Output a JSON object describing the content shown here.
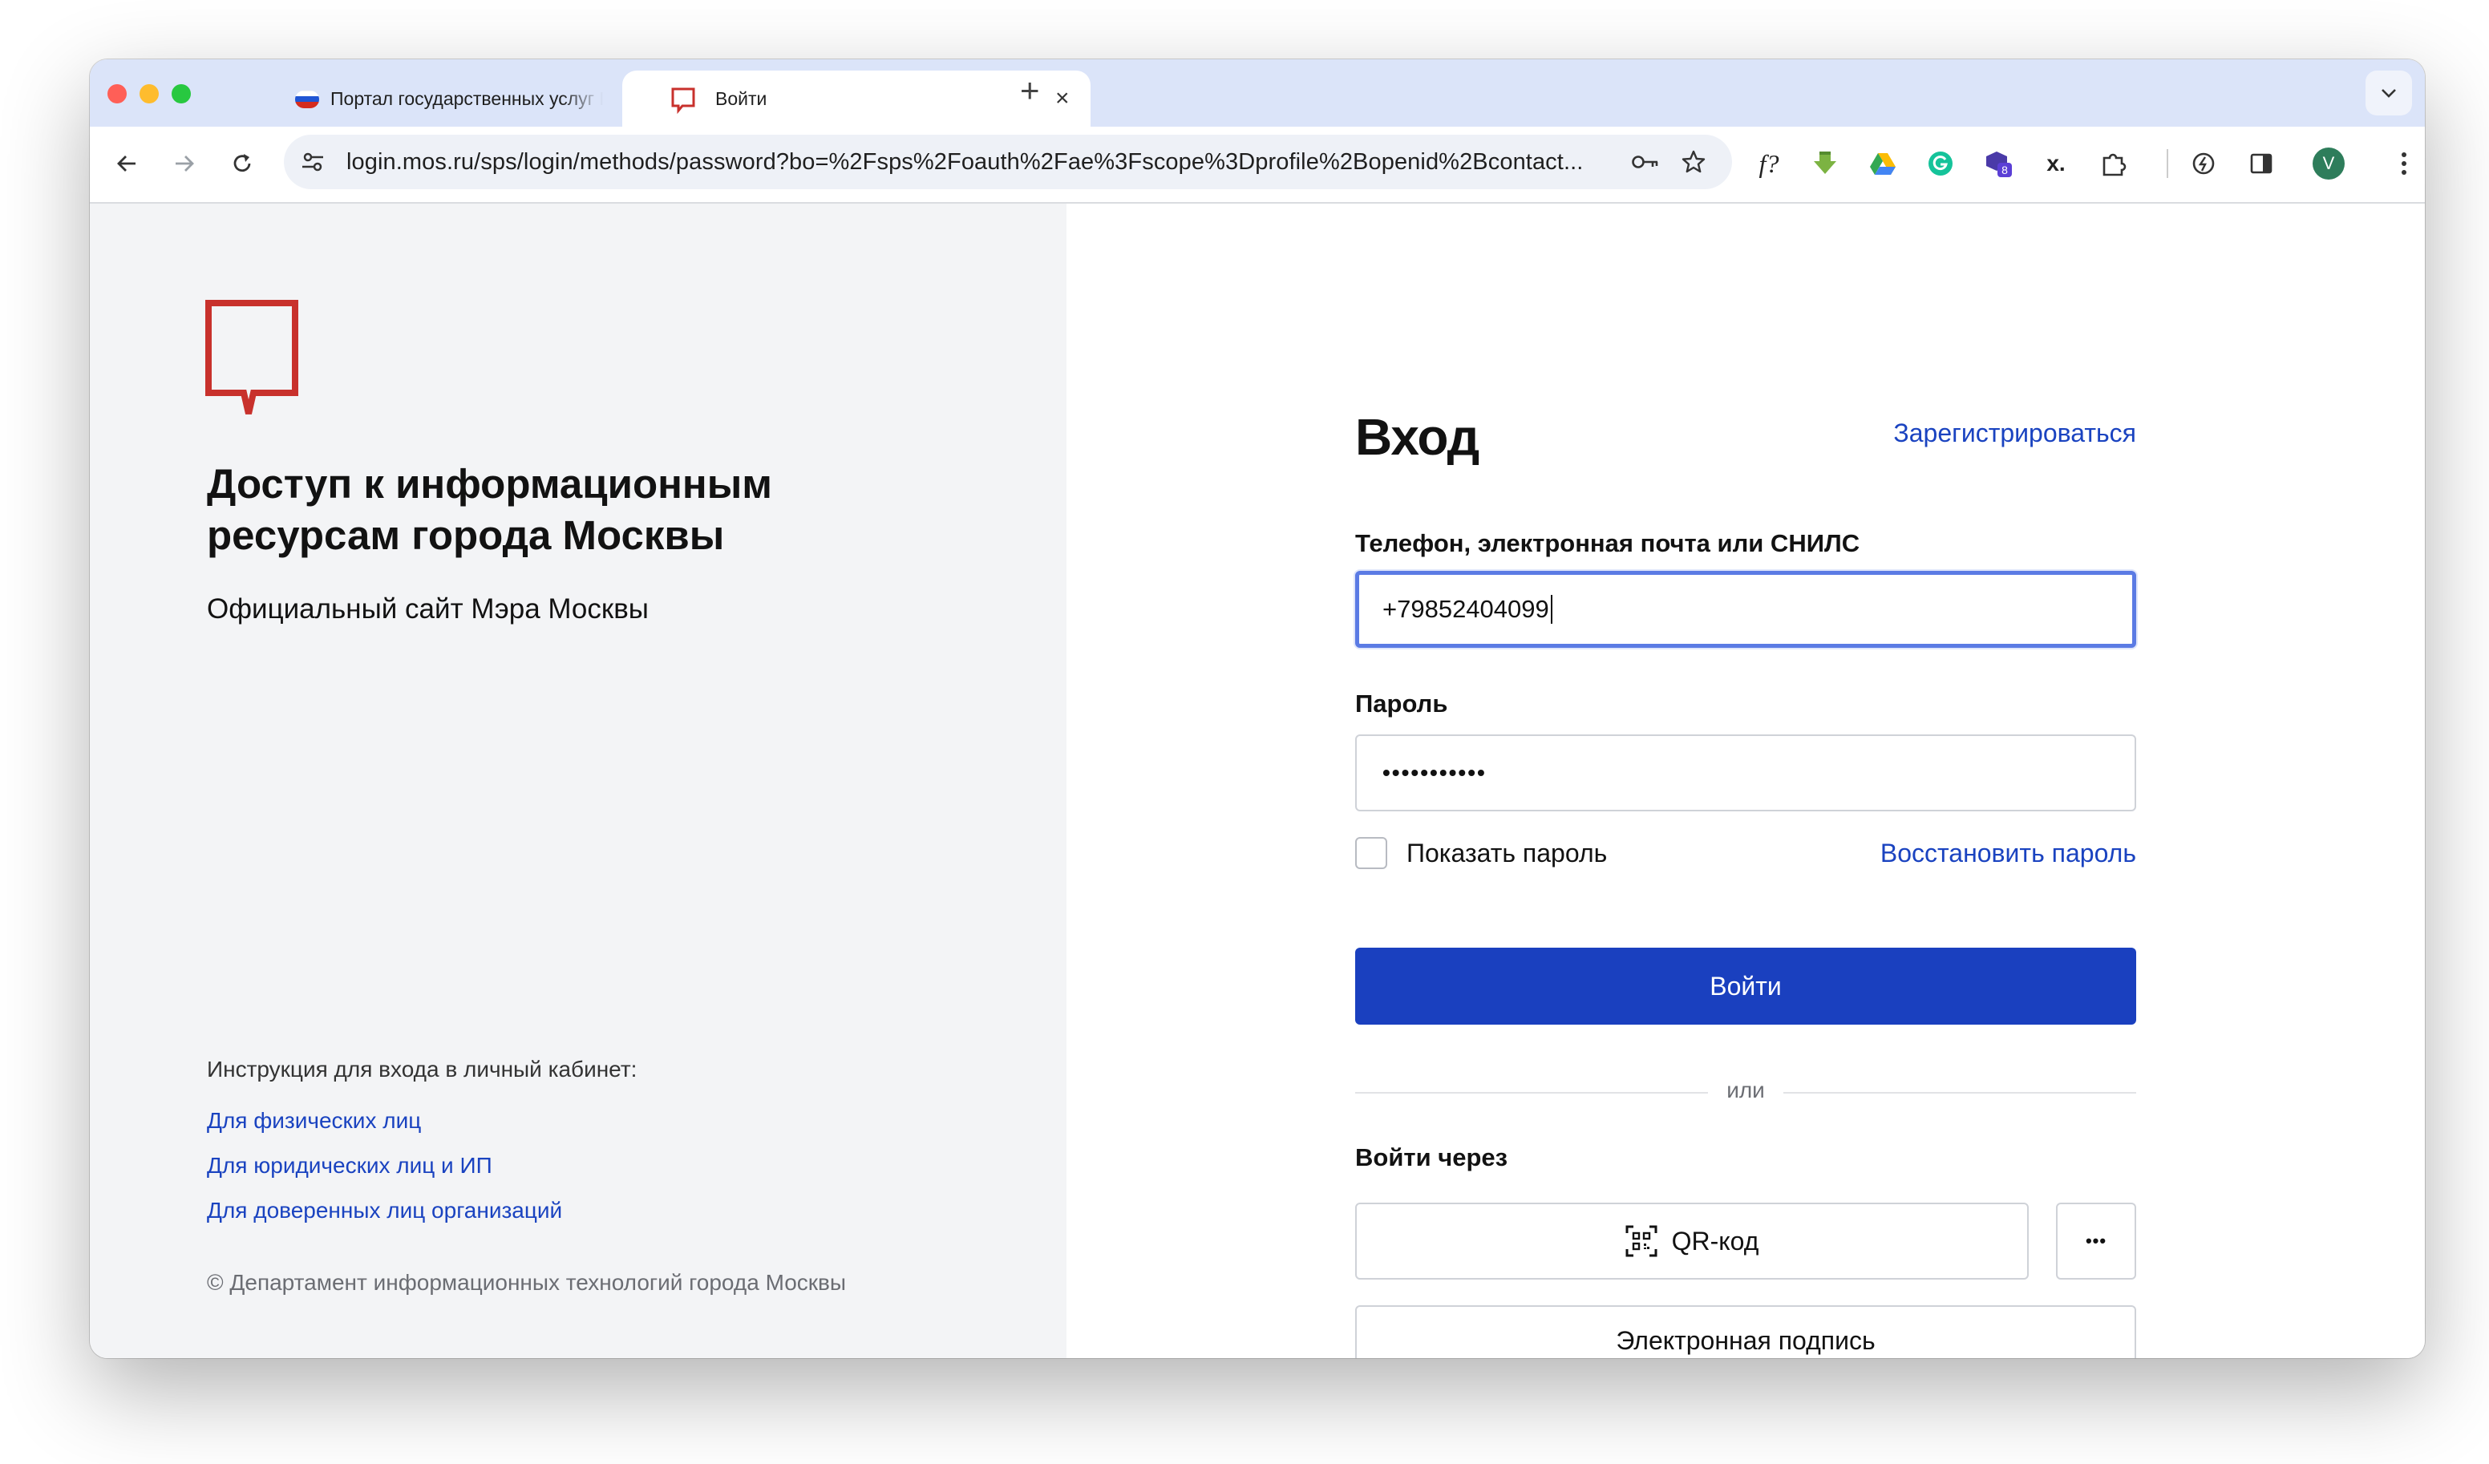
{
  "browser": {
    "tabs": [
      {
        "title": "Портал государственных услуг Российской Федерации",
        "active": false
      },
      {
        "title": "Войти",
        "active": true
      }
    ],
    "url": "login.mos.ru/sps/login/methods/password?bo=%2Fsps%2Foauth%2Fae%3Fscope%3Dprofile%2Bopenid%2Bcontact...",
    "extensions": [
      "function-icon",
      "download-icon",
      "google-drive-icon",
      "grammarly-icon",
      "extension-badge-icon",
      "x-extension-icon",
      "puzzle-icon",
      "speed-icon",
      "sidepanel-icon"
    ],
    "extension_badge": "8",
    "extension_x": "x.",
    "formula_glyph": "f?",
    "profile_initial": "V",
    "colors": {
      "tabbar": "#dbe4f9",
      "profile": "#2e7d5b"
    }
  },
  "left_panel": {
    "title": "Доступ к информационным ресурсам города Москвы",
    "subtitle": "Официальный сайт Мэра Москвы",
    "instructions_label": "Инструкция для входа в личный кабинет:",
    "links": [
      "Для физических лиц",
      "Для юридических лиц и ИП",
      "Для доверенных лиц организаций"
    ],
    "copyright": "© Департамент информационных технологий города Москвы",
    "colors": {
      "logo": "#c8312c",
      "link": "#1a43c0"
    }
  },
  "login_form": {
    "title": "Вход",
    "register_link": "Зарегистрироваться",
    "login_label": "Телефон, электронная почта или СНИЛС",
    "login_value": "+79852404099",
    "password_label": "Пароль",
    "password_value": "•••••••••••",
    "show_password_label": "Показать пароль",
    "show_password_checked": false,
    "forgot_link": "Восстановить пароль",
    "submit_label": "Войти",
    "or_label": "или",
    "via_label": "Войти через",
    "qr_button_label": "QR-код",
    "more_button_label": "•••",
    "esign_button_label": "Электронная подпись",
    "colors": {
      "primary": "#1a40bf",
      "focus": "#5b7be4"
    }
  }
}
